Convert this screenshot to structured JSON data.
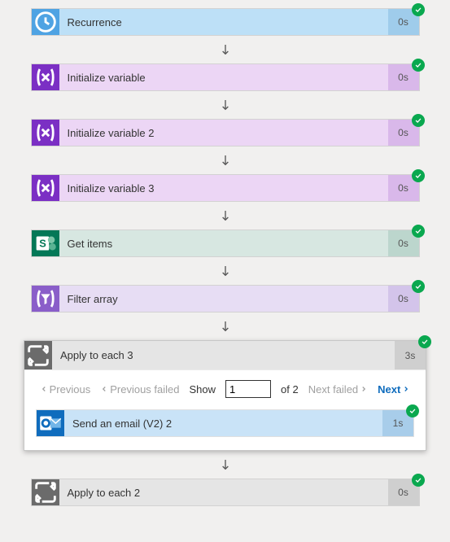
{
  "steps": {
    "recurrence": {
      "title": "Recurrence",
      "duration": "0s"
    },
    "var1": {
      "title": "Initialize variable",
      "duration": "0s"
    },
    "var2": {
      "title": "Initialize variable 2",
      "duration": "0s"
    },
    "var3": {
      "title": "Initialize variable 3",
      "duration": "0s"
    },
    "getitems": {
      "title": "Get items",
      "duration": "0s"
    },
    "filter": {
      "title": "Filter array",
      "duration": "0s"
    },
    "loop3": {
      "title": "Apply to each 3",
      "duration": "3s"
    },
    "mail": {
      "title": "Send an email (V2) 2",
      "duration": "1s"
    },
    "loop2": {
      "title": "Apply to each 2",
      "duration": "0s"
    }
  },
  "pager": {
    "previous": "Previous",
    "previous_failed": "Previous failed",
    "show": "Show",
    "current": "1",
    "of_label": "of",
    "total": "2",
    "next_failed": "Next failed",
    "next": "Next"
  }
}
